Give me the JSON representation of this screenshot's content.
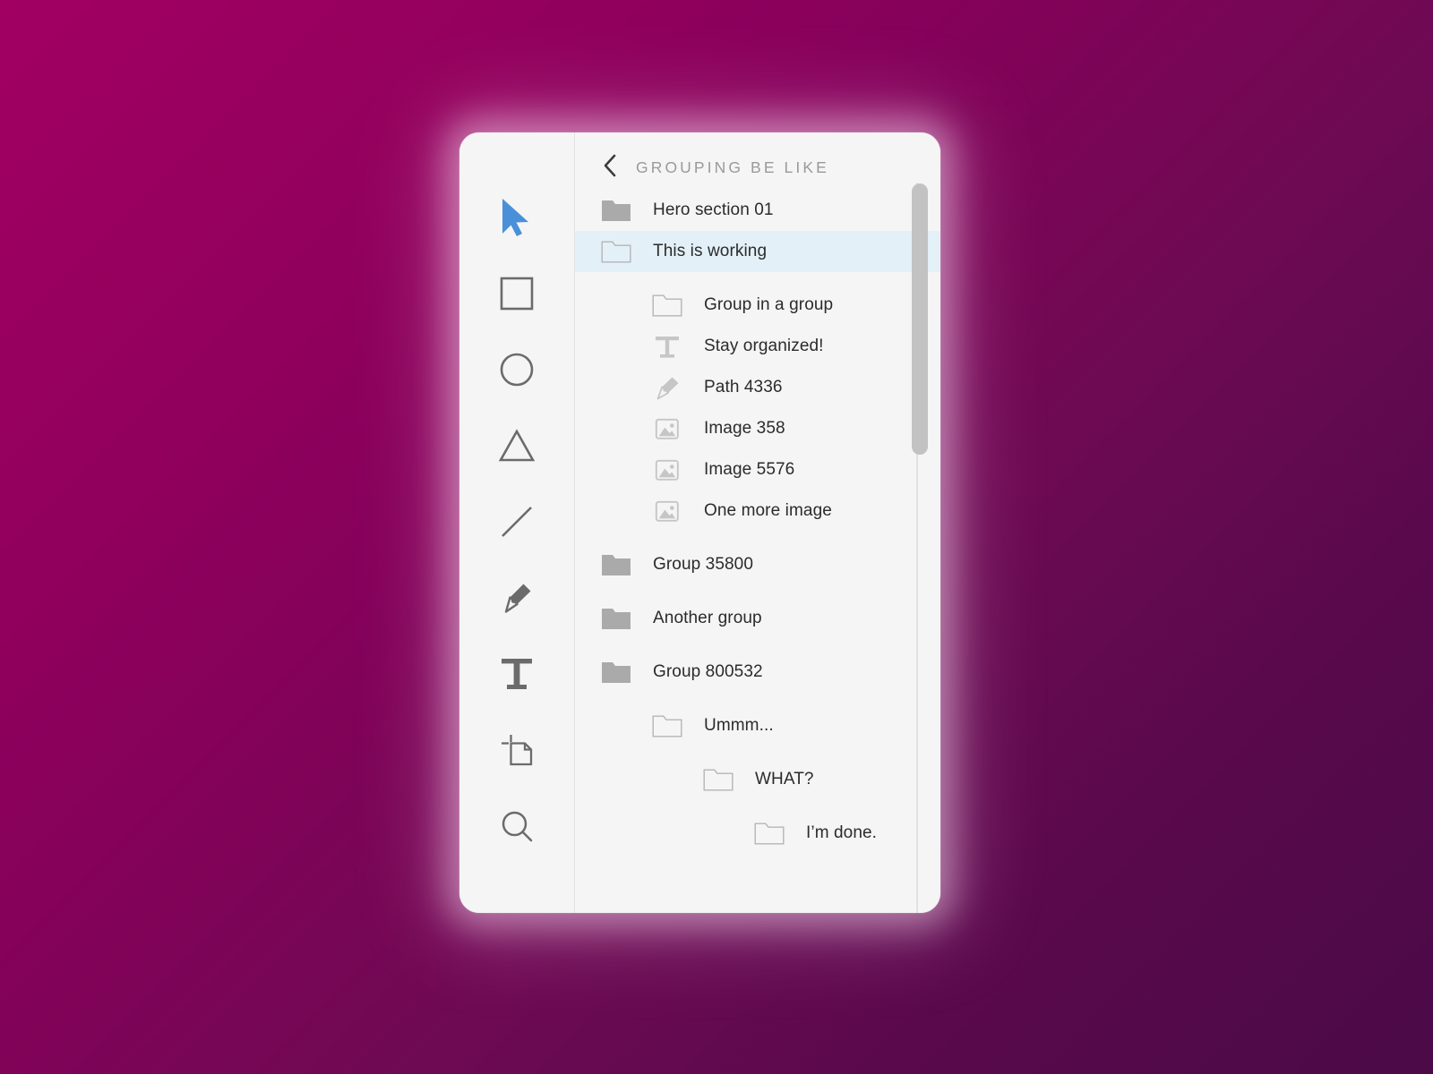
{
  "window": {
    "title": "GROUPING BE LIKE"
  },
  "theme": {
    "background_gradient_start": "#a10062",
    "background_gradient_end": "#4b0a47",
    "panel_background": "#f5f5f5",
    "selection_color": "#e4f0f8",
    "accent_color": "#4a90d9",
    "divider_color": "#e2e2e2",
    "icon_gray_filled": "#aaaaaa",
    "icon_gray_outline": "#b5b5b5",
    "text_color": "#2b2b2b",
    "title_color": "#9a9a9a",
    "scrollbar_color": "#c2c2c2"
  },
  "toolbar": {
    "tools": [
      {
        "name": "select-tool",
        "icon": "cursor-icon",
        "selected": true
      },
      {
        "name": "rectangle-tool",
        "icon": "square-icon",
        "selected": false
      },
      {
        "name": "ellipse-tool",
        "icon": "circle-icon",
        "selected": false
      },
      {
        "name": "triangle-tool",
        "icon": "triangle-icon",
        "selected": false
      },
      {
        "name": "line-tool",
        "icon": "line-icon",
        "selected": false
      },
      {
        "name": "pen-tool",
        "icon": "pen-icon",
        "selected": false
      },
      {
        "name": "text-tool",
        "icon": "text-icon",
        "selected": false
      },
      {
        "name": "artboard-tool",
        "icon": "artboard-icon",
        "selected": false
      },
      {
        "name": "zoom-tool",
        "icon": "search-icon",
        "selected": false
      }
    ]
  },
  "header": {
    "back_icon": "chevron-left-icon",
    "title": "GROUPING BE LIKE"
  },
  "layers": [
    {
      "label": "Hero section 01",
      "icon": "folder-filled-icon",
      "depth": 0,
      "selected": false,
      "gap_before": false
    },
    {
      "label": "This is working",
      "icon": "folder-outline-icon",
      "depth": 0,
      "selected": true,
      "gap_before": false
    },
    {
      "label": "Group in a group",
      "icon": "folder-outline-icon",
      "depth": 1,
      "selected": false,
      "gap_before": true
    },
    {
      "label": "Stay organized!",
      "icon": "text-layer-icon",
      "depth": 1,
      "selected": false,
      "gap_before": false
    },
    {
      "label": "Path 4336",
      "icon": "path-icon",
      "depth": 1,
      "selected": false,
      "gap_before": false
    },
    {
      "label": "Image 358",
      "icon": "image-icon",
      "depth": 1,
      "selected": false,
      "gap_before": false
    },
    {
      "label": "Image 5576",
      "icon": "image-icon",
      "depth": 1,
      "selected": false,
      "gap_before": false
    },
    {
      "label": "One more image",
      "icon": "image-icon",
      "depth": 1,
      "selected": false,
      "gap_before": false
    },
    {
      "label": "Group 35800",
      "icon": "folder-filled-icon",
      "depth": 0,
      "selected": false,
      "gap_before": true
    },
    {
      "label": "Another group",
      "icon": "folder-filled-icon",
      "depth": 0,
      "selected": false,
      "gap_before": true
    },
    {
      "label": "Group 800532",
      "icon": "folder-filled-icon",
      "depth": 0,
      "selected": false,
      "gap_before": true
    },
    {
      "label": "Ummm...",
      "icon": "folder-outline-icon",
      "depth": 1,
      "selected": false,
      "gap_before": true
    },
    {
      "label": "WHAT?",
      "icon": "folder-outline-icon",
      "depth": 2,
      "selected": false,
      "gap_before": true
    },
    {
      "label": "I’m done.",
      "icon": "folder-outline-icon",
      "depth": 3,
      "selected": false,
      "gap_before": true
    }
  ],
  "scrollbar": {
    "name": "vertical-scrollbar"
  }
}
